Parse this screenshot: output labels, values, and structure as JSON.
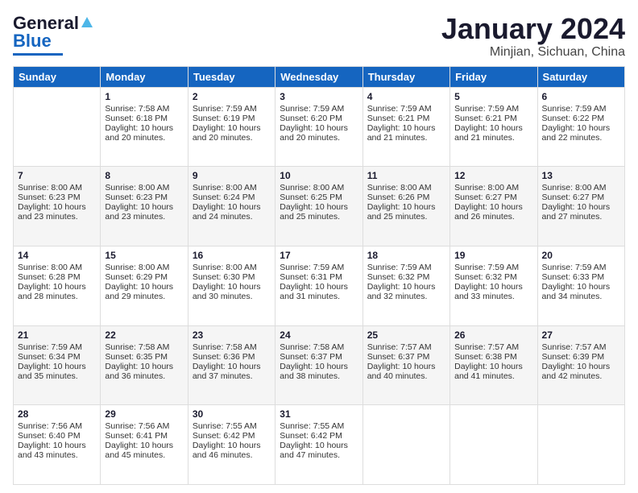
{
  "logo": {
    "line1": "General",
    "line2": "Blue"
  },
  "title": "January 2024",
  "location": "Minjian, Sichuan, China",
  "days": [
    "Sunday",
    "Monday",
    "Tuesday",
    "Wednesday",
    "Thursday",
    "Friday",
    "Saturday"
  ],
  "weeks": [
    [
      {
        "day": "",
        "sunrise": "",
        "sunset": "",
        "daylight": ""
      },
      {
        "day": "1",
        "sunrise": "Sunrise: 7:58 AM",
        "sunset": "Sunset: 6:18 PM",
        "daylight": "Daylight: 10 hours and 20 minutes."
      },
      {
        "day": "2",
        "sunrise": "Sunrise: 7:59 AM",
        "sunset": "Sunset: 6:19 PM",
        "daylight": "Daylight: 10 hours and 20 minutes."
      },
      {
        "day": "3",
        "sunrise": "Sunrise: 7:59 AM",
        "sunset": "Sunset: 6:20 PM",
        "daylight": "Daylight: 10 hours and 20 minutes."
      },
      {
        "day": "4",
        "sunrise": "Sunrise: 7:59 AM",
        "sunset": "Sunset: 6:21 PM",
        "daylight": "Daylight: 10 hours and 21 minutes."
      },
      {
        "day": "5",
        "sunrise": "Sunrise: 7:59 AM",
        "sunset": "Sunset: 6:21 PM",
        "daylight": "Daylight: 10 hours and 21 minutes."
      },
      {
        "day": "6",
        "sunrise": "Sunrise: 7:59 AM",
        "sunset": "Sunset: 6:22 PM",
        "daylight": "Daylight: 10 hours and 22 minutes."
      }
    ],
    [
      {
        "day": "7",
        "sunrise": "Sunrise: 8:00 AM",
        "sunset": "Sunset: 6:23 PM",
        "daylight": "Daylight: 10 hours and 23 minutes."
      },
      {
        "day": "8",
        "sunrise": "Sunrise: 8:00 AM",
        "sunset": "Sunset: 6:23 PM",
        "daylight": "Daylight: 10 hours and 23 minutes."
      },
      {
        "day": "9",
        "sunrise": "Sunrise: 8:00 AM",
        "sunset": "Sunset: 6:24 PM",
        "daylight": "Daylight: 10 hours and 24 minutes."
      },
      {
        "day": "10",
        "sunrise": "Sunrise: 8:00 AM",
        "sunset": "Sunset: 6:25 PM",
        "daylight": "Daylight: 10 hours and 25 minutes."
      },
      {
        "day": "11",
        "sunrise": "Sunrise: 8:00 AM",
        "sunset": "Sunset: 6:26 PM",
        "daylight": "Daylight: 10 hours and 25 minutes."
      },
      {
        "day": "12",
        "sunrise": "Sunrise: 8:00 AM",
        "sunset": "Sunset: 6:27 PM",
        "daylight": "Daylight: 10 hours and 26 minutes."
      },
      {
        "day": "13",
        "sunrise": "Sunrise: 8:00 AM",
        "sunset": "Sunset: 6:27 PM",
        "daylight": "Daylight: 10 hours and 27 minutes."
      }
    ],
    [
      {
        "day": "14",
        "sunrise": "Sunrise: 8:00 AM",
        "sunset": "Sunset: 6:28 PM",
        "daylight": "Daylight: 10 hours and 28 minutes."
      },
      {
        "day": "15",
        "sunrise": "Sunrise: 8:00 AM",
        "sunset": "Sunset: 6:29 PM",
        "daylight": "Daylight: 10 hours and 29 minutes."
      },
      {
        "day": "16",
        "sunrise": "Sunrise: 8:00 AM",
        "sunset": "Sunset: 6:30 PM",
        "daylight": "Daylight: 10 hours and 30 minutes."
      },
      {
        "day": "17",
        "sunrise": "Sunrise: 7:59 AM",
        "sunset": "Sunset: 6:31 PM",
        "daylight": "Daylight: 10 hours and 31 minutes."
      },
      {
        "day": "18",
        "sunrise": "Sunrise: 7:59 AM",
        "sunset": "Sunset: 6:32 PM",
        "daylight": "Daylight: 10 hours and 32 minutes."
      },
      {
        "day": "19",
        "sunrise": "Sunrise: 7:59 AM",
        "sunset": "Sunset: 6:32 PM",
        "daylight": "Daylight: 10 hours and 33 minutes."
      },
      {
        "day": "20",
        "sunrise": "Sunrise: 7:59 AM",
        "sunset": "Sunset: 6:33 PM",
        "daylight": "Daylight: 10 hours and 34 minutes."
      }
    ],
    [
      {
        "day": "21",
        "sunrise": "Sunrise: 7:59 AM",
        "sunset": "Sunset: 6:34 PM",
        "daylight": "Daylight: 10 hours and 35 minutes."
      },
      {
        "day": "22",
        "sunrise": "Sunrise: 7:58 AM",
        "sunset": "Sunset: 6:35 PM",
        "daylight": "Daylight: 10 hours and 36 minutes."
      },
      {
        "day": "23",
        "sunrise": "Sunrise: 7:58 AM",
        "sunset": "Sunset: 6:36 PM",
        "daylight": "Daylight: 10 hours and 37 minutes."
      },
      {
        "day": "24",
        "sunrise": "Sunrise: 7:58 AM",
        "sunset": "Sunset: 6:37 PM",
        "daylight": "Daylight: 10 hours and 38 minutes."
      },
      {
        "day": "25",
        "sunrise": "Sunrise: 7:57 AM",
        "sunset": "Sunset: 6:37 PM",
        "daylight": "Daylight: 10 hours and 40 minutes."
      },
      {
        "day": "26",
        "sunrise": "Sunrise: 7:57 AM",
        "sunset": "Sunset: 6:38 PM",
        "daylight": "Daylight: 10 hours and 41 minutes."
      },
      {
        "day": "27",
        "sunrise": "Sunrise: 7:57 AM",
        "sunset": "Sunset: 6:39 PM",
        "daylight": "Daylight: 10 hours and 42 minutes."
      }
    ],
    [
      {
        "day": "28",
        "sunrise": "Sunrise: 7:56 AM",
        "sunset": "Sunset: 6:40 PM",
        "daylight": "Daylight: 10 hours and 43 minutes."
      },
      {
        "day": "29",
        "sunrise": "Sunrise: 7:56 AM",
        "sunset": "Sunset: 6:41 PM",
        "daylight": "Daylight: 10 hours and 45 minutes."
      },
      {
        "day": "30",
        "sunrise": "Sunrise: 7:55 AM",
        "sunset": "Sunset: 6:42 PM",
        "daylight": "Daylight: 10 hours and 46 minutes."
      },
      {
        "day": "31",
        "sunrise": "Sunrise: 7:55 AM",
        "sunset": "Sunset: 6:42 PM",
        "daylight": "Daylight: 10 hours and 47 minutes."
      },
      {
        "day": "",
        "sunrise": "",
        "sunset": "",
        "daylight": ""
      },
      {
        "day": "",
        "sunrise": "",
        "sunset": "",
        "daylight": ""
      },
      {
        "day": "",
        "sunrise": "",
        "sunset": "",
        "daylight": ""
      }
    ]
  ]
}
